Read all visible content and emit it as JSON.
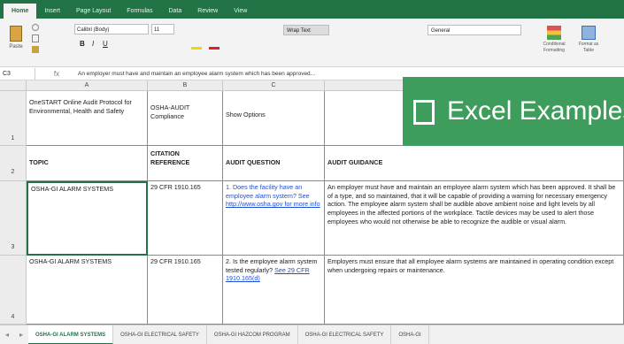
{
  "ribbon_tabs": [
    "Home",
    "Insert",
    "Page Layout",
    "Formulas",
    "Data",
    "Review",
    "View"
  ],
  "active_ribbon_tab": "Home",
  "ribbon": {
    "paste_label": "Paste",
    "font_name": "Calibri (Body)",
    "font_size": "11",
    "wrap_text_label": "Wrap Text",
    "number_format": "General",
    "conditional_label": "Conditional Formatting",
    "format_table_label": "Format as Table"
  },
  "formula_bar": {
    "name_box": "C3",
    "fx": "fx",
    "content": "An employer must have and maintain an employee alarm system which has been approved..."
  },
  "columns": [
    "A",
    "B",
    "C"
  ],
  "rows": [
    {
      "num": "1",
      "a": "OneSTART Online Audit Protocol for Environmental, Health and Safety",
      "b": "OSHA-AUDIT Compliance",
      "c": "Show Options",
      "d": ""
    },
    {
      "num": "2",
      "a": "TOPIC",
      "b": "CITATION REFERENCE",
      "c": "AUDIT QUESTION",
      "d": "AUDIT GUIDANCE"
    },
    {
      "num": "3",
      "a": "OSHA-GI ALARM SYSTEMS",
      "b": "29 CFR 1910.165",
      "c_text": "1. Does the facility have an employee alarm system? See",
      "c_link": "http://www.osha.gov for more info",
      "d": "An employer must have and maintain an employee alarm system which has been approved. It shall be of a type, and so maintained, that it will be capable of providing a warning for necessary emergency action. The employee alarm system shall be audible above ambient noise and light levels by all employees in the affected portions of the workplace. Tactile devices may be used to alert those employees who would not otherwise be able to recognize the audible or visual alarm."
    },
    {
      "num": "4",
      "a": "OSHA-GI ALARM SYSTEMS",
      "b": "29 CFR 1910.165",
      "c_text": "2. Is the employee alarm system tested regularly?",
      "c_link": "See 29 CFR 1910.165(d)",
      "d": "Employers must ensure that all employee alarm systems are maintained in operating condition except when undergoing repairs or maintenance."
    }
  ],
  "banner_text": "Excel Examples",
  "sheet_tabs": [
    "OSHA-GI ALARM SYSTEMS",
    "OSHA-GI ELECTRICAL SAFETY",
    "OSHA-GI HAZCOM PROGRAM",
    "OSHA-GI ELECTRICAL SAFETY",
    "OSHA-GI"
  ],
  "active_sheet": "OSHA-GI ALARM SYSTEMS",
  "colors": {
    "excel_green": "#217346",
    "banner_green": "#3e9d5d",
    "link": "#1f4fd6"
  }
}
